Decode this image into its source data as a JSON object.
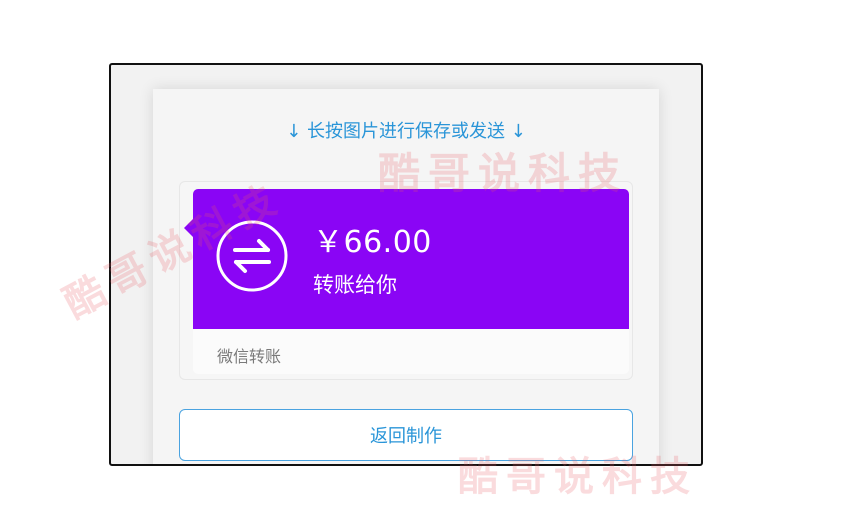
{
  "hint": {
    "text": "↓ 长按图片进行保存或发送 ↓"
  },
  "card": {
    "amount": "￥66.00",
    "subtitle": "转账给你",
    "source": "微信转账",
    "icon": "transfer-arrows-icon",
    "color": "#8a05f5"
  },
  "actions": {
    "back_label": "返回制作"
  },
  "watermark": {
    "text": "酷哥说科技"
  },
  "colors": {
    "accent": "#2a95d8",
    "card_purple": "#8a05f5"
  }
}
